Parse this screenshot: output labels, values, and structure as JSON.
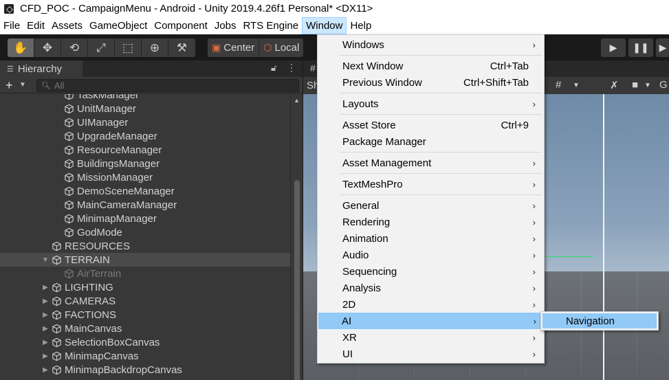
{
  "window": {
    "title": "CFD_POC - CampaignMenu - Android - Unity 2019.4.26f1 Personal* <DX11>"
  },
  "menubar": {
    "items": [
      "File",
      "Edit",
      "Assets",
      "GameObject",
      "Component",
      "Jobs",
      "RTS Engine",
      "Window",
      "Help"
    ],
    "active": "Window"
  },
  "toolbar": {
    "tools": [
      "hand-icon",
      "move-icon",
      "rotate-icon",
      "scale-icon",
      "rect-icon",
      "transform-icon",
      "custom-tool-icon"
    ],
    "pivot_label": "Center",
    "space_label": "Local"
  },
  "hierarchy": {
    "tab_label": "Hierarchy",
    "search_placeholder": "All",
    "items": [
      {
        "label": "TaskManager",
        "depth": 2,
        "expandable": false
      },
      {
        "label": "UnitManager",
        "depth": 2,
        "expandable": false
      },
      {
        "label": "UIManager",
        "depth": 2,
        "expandable": false
      },
      {
        "label": "UpgradeManager",
        "depth": 2,
        "expandable": false
      },
      {
        "label": "ResourceManager",
        "depth": 2,
        "expandable": false
      },
      {
        "label": "BuildingsManager",
        "depth": 2,
        "expandable": false
      },
      {
        "label": "MissionManager",
        "depth": 2,
        "expandable": false
      },
      {
        "label": "DemoSceneManager",
        "depth": 2,
        "expandable": false
      },
      {
        "label": "MainCameraManager",
        "depth": 2,
        "expandable": false
      },
      {
        "label": "MinimapManager",
        "depth": 2,
        "expandable": false
      },
      {
        "label": "GodMode",
        "depth": 2,
        "expandable": false
      },
      {
        "label": "RESOURCES",
        "depth": 1,
        "expandable": false
      },
      {
        "label": "TERRAIN",
        "depth": 1,
        "expandable": true,
        "expanded": true,
        "selected": true
      },
      {
        "label": "AirTerrain",
        "depth": 2,
        "expandable": false,
        "disabled": true
      },
      {
        "label": "LIGHTING",
        "depth": 1,
        "expandable": true
      },
      {
        "label": "CAMERAS",
        "depth": 1,
        "expandable": true
      },
      {
        "label": "FACTIONS",
        "depth": 1,
        "expandable": true
      },
      {
        "label": "MainCanvas",
        "depth": 1,
        "expandable": true
      },
      {
        "label": "SelectionBoxCanvas",
        "depth": 1,
        "expandable": true
      },
      {
        "label": "MinimapCanvas",
        "depth": 1,
        "expandable": true
      },
      {
        "label": "MinimapBackdropCanvas",
        "depth": 1,
        "expandable": true
      }
    ]
  },
  "scene": {
    "tab_partial": "#",
    "toolbar_partial": "Sh",
    "right_partial": "G"
  },
  "window_menu": {
    "items": [
      {
        "label": "Windows",
        "shortcut": "",
        "submenu": true
      },
      {
        "separator": true
      },
      {
        "label": "Next Window",
        "shortcut": "Ctrl+Tab",
        "submenu": false
      },
      {
        "label": "Previous Window",
        "shortcut": "Ctrl+Shift+Tab",
        "submenu": false
      },
      {
        "separator": true
      },
      {
        "label": "Layouts",
        "shortcut": "",
        "submenu": true
      },
      {
        "separator": true
      },
      {
        "label": "Asset Store",
        "shortcut": "Ctrl+9",
        "submenu": false
      },
      {
        "label": "Package Manager",
        "shortcut": "",
        "submenu": false
      },
      {
        "separator": true
      },
      {
        "label": "Asset Management",
        "shortcut": "",
        "submenu": true
      },
      {
        "separator": true
      },
      {
        "label": "TextMeshPro",
        "shortcut": "",
        "submenu": true
      },
      {
        "separator": true
      },
      {
        "label": "General",
        "shortcut": "",
        "submenu": true
      },
      {
        "label": "Rendering",
        "shortcut": "",
        "submenu": true
      },
      {
        "label": "Animation",
        "shortcut": "",
        "submenu": true
      },
      {
        "label": "Audio",
        "shortcut": "",
        "submenu": true
      },
      {
        "label": "Sequencing",
        "shortcut": "",
        "submenu": true
      },
      {
        "label": "Analysis",
        "shortcut": "",
        "submenu": true
      },
      {
        "label": "2D",
        "shortcut": "",
        "submenu": true
      },
      {
        "label": "AI",
        "shortcut": "",
        "submenu": true,
        "highlighted": true
      },
      {
        "label": "XR",
        "shortcut": "",
        "submenu": true
      },
      {
        "label": "UI",
        "shortcut": "",
        "submenu": true
      }
    ]
  },
  "ai_submenu": {
    "items": [
      "Navigation"
    ]
  },
  "colors": {
    "menu_highlight": "#91c9f7",
    "menubar_active": "#cce8ff",
    "panel_bg": "#383838",
    "toolbar_bg": "#191919"
  }
}
